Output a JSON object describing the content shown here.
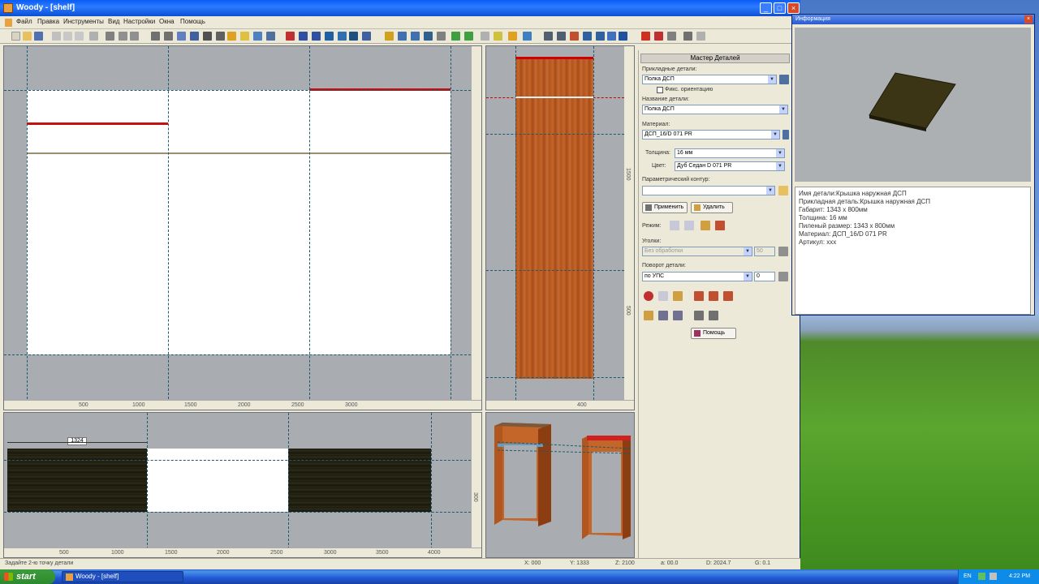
{
  "app": {
    "title": "Woody - [shelf]",
    "menu": [
      "Файл",
      "Правка",
      "Инструменты",
      "Вид",
      "Настройки",
      "Окна",
      "Помощь"
    ]
  },
  "top_left_view": {
    "ruler": [
      "500",
      "1000",
      "1500",
      "2000",
      "2500",
      "3000"
    ]
  },
  "top_right_view": {
    "ruler_bottom": [
      "200",
      "400"
    ],
    "ruler_side": [
      "1500",
      "1000",
      "500"
    ]
  },
  "bottom_left_view": {
    "dimension": "1324",
    "ruler": [
      "500",
      "1000",
      "1500",
      "2000",
      "2500",
      "3000",
      "3500",
      "4000"
    ],
    "ruler_side": "300"
  },
  "master": {
    "header": "Мастер Деталей",
    "applied_label": "Прикладные детали:",
    "applied_value": "Полка ДСП",
    "fix_orientation": "Фикс. ориентацию",
    "name_label": "Название детали:",
    "name_value": "Полка ДСП",
    "material_label": "Материал:",
    "material_value": "ДСП_16/D 071 PR",
    "thickness_label": "Толщина:",
    "thickness_value": "16 мм",
    "color_label": "Цвет:",
    "color_value": "Дуб Седан D 071 PR",
    "contour_label": "Параметрический контур:",
    "apply_button": "Применить",
    "delete_button": "Удалить",
    "mode_label": "Режим:",
    "corners_label": "Уголки:",
    "corners_value": "Без обработки",
    "corners_num": "50",
    "rotate_label": "Поворот детали:",
    "rotate_value": "по УПС",
    "rotate_num": "0",
    "help_button": "Помощь"
  },
  "status": {
    "hint": "Задайте 2-ю точку детали",
    "x": "X: 000",
    "y": "Y: 1333",
    "z": "Z: 2100",
    "a": "a: 00.0",
    "d": "D: 2024.7",
    "g": "G: 0.1"
  },
  "info": {
    "title": "Информация",
    "lines": [
      "Имя детали:Крышка наружная ДСП",
      "Прикладная деталь:Крышка наружная ДСП",
      "Габарит: 1343 х 800мм",
      "Толщина: 16 мм",
      "Пиленый размер: 1343 х 800мм",
      "Материал: ДСП_16/D 071 PR",
      "Артикул: ххх"
    ]
  },
  "taskbar": {
    "start": "start",
    "task": "Woody - [shelf]",
    "lang": "EN",
    "time": "4:22 PM"
  },
  "colors": {
    "titlebar": "#0a5cf5",
    "app_bg": "#ece9d8",
    "viewport_bg": "#a9adb1",
    "guide_line": "#1e5a6e",
    "accent_red": "#d00000"
  }
}
